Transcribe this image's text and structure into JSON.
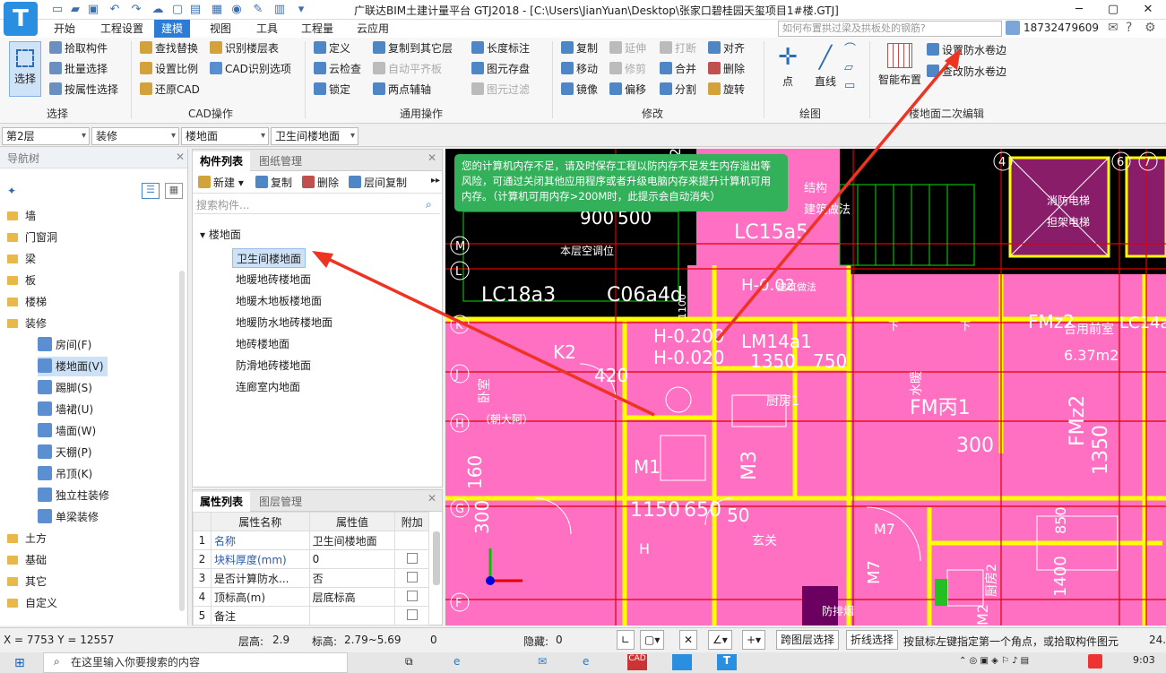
{
  "app": {
    "title": "广联达BIM土建计量平台 GTJ2018 - [C:\\Users\\JianYuan\\Desktop\\张家口碧桂园天玺项目1#楼.GTJ]"
  },
  "menu": {
    "tabs": [
      "开始",
      "工程设置",
      "建模",
      "视图",
      "工具",
      "工程量",
      "云应用"
    ],
    "search_placeholder": "如何布置拱过梁及拱板处的钢筋?",
    "phone": "18732479609"
  },
  "ribbon": {
    "select": {
      "label": "选择",
      "items": [
        "拾取构件",
        "批量选择",
        "按属性选择"
      ],
      "group": "选择"
    },
    "cad": {
      "items": [
        "查找替换",
        "识别楼层表",
        "设置比例",
        "CAD识别选项",
        "还原CAD"
      ],
      "group": "CAD操作"
    },
    "common": {
      "items": [
        "定义",
        "复制到其它层",
        "长度标注",
        "云检查",
        "自动平齐板",
        "图元存盘",
        "锁定",
        "两点辅轴",
        "图元过滤"
      ],
      "group": "通用操作"
    },
    "modify": {
      "items": [
        "复制",
        "延伸",
        "打断",
        "对齐",
        "移动",
        "修剪",
        "合并",
        "删除",
        "镜像",
        "偏移",
        "分割",
        "旋转"
      ],
      "group": "修改"
    },
    "draw": {
      "items": [
        "点",
        "直线"
      ],
      "group": "绘图"
    },
    "floor": {
      "items": [
        "智能布置",
        "设置防水卷边",
        "查改防水卷边"
      ],
      "group": "楼地面二次编辑"
    }
  },
  "selectors": [
    "第2层",
    "装修",
    "楼地面",
    "卫生间楼地面"
  ],
  "nav": {
    "title": "导航树",
    "items": [
      {
        "label": "墙",
        "type": "folder"
      },
      {
        "label": "门窗洞",
        "type": "folder"
      },
      {
        "label": "梁",
        "type": "folder"
      },
      {
        "label": "板",
        "type": "folder"
      },
      {
        "label": "楼梯",
        "type": "folder"
      },
      {
        "label": "装修",
        "type": "folder"
      },
      {
        "label": "房间(F)",
        "type": "sub"
      },
      {
        "label": "楼地面(V)",
        "type": "sub",
        "selected": true
      },
      {
        "label": "踢脚(S)",
        "type": "sub"
      },
      {
        "label": "墙裙(U)",
        "type": "sub"
      },
      {
        "label": "墙面(W)",
        "type": "sub"
      },
      {
        "label": "天棚(P)",
        "type": "sub"
      },
      {
        "label": "吊顶(K)",
        "type": "sub"
      },
      {
        "label": "独立柱装修",
        "type": "sub"
      },
      {
        "label": "单梁装修",
        "type": "sub"
      },
      {
        "label": "土方",
        "type": "folder"
      },
      {
        "label": "基础",
        "type": "folder"
      },
      {
        "label": "其它",
        "type": "folder"
      },
      {
        "label": "自定义",
        "type": "folder"
      }
    ]
  },
  "components": {
    "tabs": [
      "构件列表",
      "图纸管理"
    ],
    "toolbar": [
      "新建",
      "复制",
      "删除",
      "层间复制"
    ],
    "search_placeholder": "搜索构件...",
    "root": "楼地面",
    "items": [
      "卫生间楼地面",
      "地暖地砖楼地面",
      "地暖木地板楼地面",
      "地暖防水地砖楼地面",
      "地砖楼地面",
      "防滑地砖楼地面",
      "连廊室内地面"
    ]
  },
  "properties": {
    "tabs": [
      "属性列表",
      "图层管理"
    ],
    "headers": [
      "属性名称",
      "属性值",
      "附加"
    ],
    "rows": [
      {
        "n": "1",
        "name": "名称",
        "value": "卫生间楼地面",
        "blue": true
      },
      {
        "n": "2",
        "name": "块料厚度(mm)",
        "value": "0",
        "blue": true
      },
      {
        "n": "3",
        "name": "是否计算防水...",
        "value": "否",
        "blue": false
      },
      {
        "n": "4",
        "name": "顶标高(m)",
        "value": "层底标高",
        "blue": false
      },
      {
        "n": "5",
        "name": "备注",
        "value": "",
        "blue": false
      }
    ]
  },
  "notice": "您的计算机内存不足，请及时保存工程以防内存不足发生内存溢出等风险，可通过关闭其他应用程序或者升级电脑内存来提升计算机可用内存。（计算机可用内存>200M时，此提示会自动消失）",
  "canvas": {
    "labels": [
      "900",
      "500",
      "11100200",
      "LC15a5",
      "本层空调位",
      "LC18a3",
      "C06a4d",
      "H-0.02",
      "建筑做法",
      "K2",
      "H-0.200",
      "H-0.020",
      "420",
      "LM14a1",
      "1350",
      "750",
      "FMz2",
      "合用前室",
      "6.37m2",
      "LC14a1",
      "卧室",
      "（朝大阿）",
      "厨房1",
      "水暖",
      "FM丙1",
      "300",
      "FMz2",
      "1350",
      "M1",
      "M3",
      "1150",
      "650",
      "50",
      "H",
      "玄关",
      "M7",
      "M7",
      "厨房2",
      "850",
      "1400",
      "M2",
      "结构",
      "建筑做法",
      "1100",
      "300",
      "160",
      "防排烟",
      "消防电梯",
      "担架电梯",
      "下",
      "下"
    ],
    "axes": [
      "M",
      "L",
      "K",
      "J",
      "H",
      "G",
      "F",
      "4",
      "6",
      "7"
    ]
  },
  "status": {
    "coords": "X = 7753 Y = 12557",
    "layer_h_label": "层高:",
    "layer_h": "2.9",
    "elev_label": "标高:",
    "elev": "2.79~5.69",
    "zero": "0",
    "hidden_label": "隐藏:",
    "hidden": "0",
    "btn1": "跨图层选择",
    "btn2": "折线选择",
    "hint": "按鼠标左键指定第一个角点，或拾取构件图元",
    "scale": "24."
  },
  "taskbar": {
    "search": "在这里输入你要搜索的内容",
    "time": "9:03"
  }
}
